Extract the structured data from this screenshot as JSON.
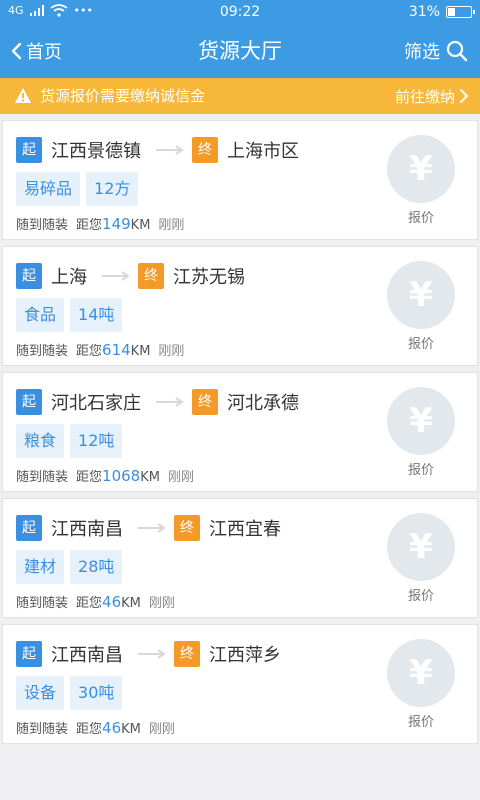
{
  "status_bar": {
    "network": "4G",
    "time": "09:22",
    "battery_percent": "31%",
    "battery_level": 0.31
  },
  "nav": {
    "back_label": "首页",
    "title": "货源大厅",
    "filter_label": "筛选"
  },
  "notice": {
    "text": "货源报价需要缴纳诚信金",
    "action": "前往缴纳"
  },
  "labels": {
    "start_tag": "起",
    "end_tag": "终",
    "quote_symbol": "¥",
    "quote_label": "报价",
    "distance_prefix": "距您",
    "distance_unit": "KM"
  },
  "cards": [
    {
      "from": "江西景德镇",
      "to": "上海市区",
      "cargo": "易碎品",
      "amount": "12方",
      "loading": "随到随装",
      "distance": "149",
      "time": "刚刚"
    },
    {
      "from": "上海",
      "to": "江苏无锡",
      "cargo": "食品",
      "amount": "14吨",
      "loading": "随到随装",
      "distance": "614",
      "time": "刚刚"
    },
    {
      "from": "河北石家庄",
      "to": "河北承德",
      "cargo": "粮食",
      "amount": "12吨",
      "loading": "随到随装",
      "distance": "1068",
      "time": "刚刚"
    },
    {
      "from": "江西南昌",
      "to": "江西宜春",
      "cargo": "建材",
      "amount": "28吨",
      "loading": "随到随装",
      "distance": "46",
      "time": "刚刚"
    },
    {
      "from": "江西南昌",
      "to": "江西萍乡",
      "cargo": "设备",
      "amount": "30吨",
      "loading": "随到随装",
      "distance": "46",
      "time": "刚刚"
    }
  ]
}
